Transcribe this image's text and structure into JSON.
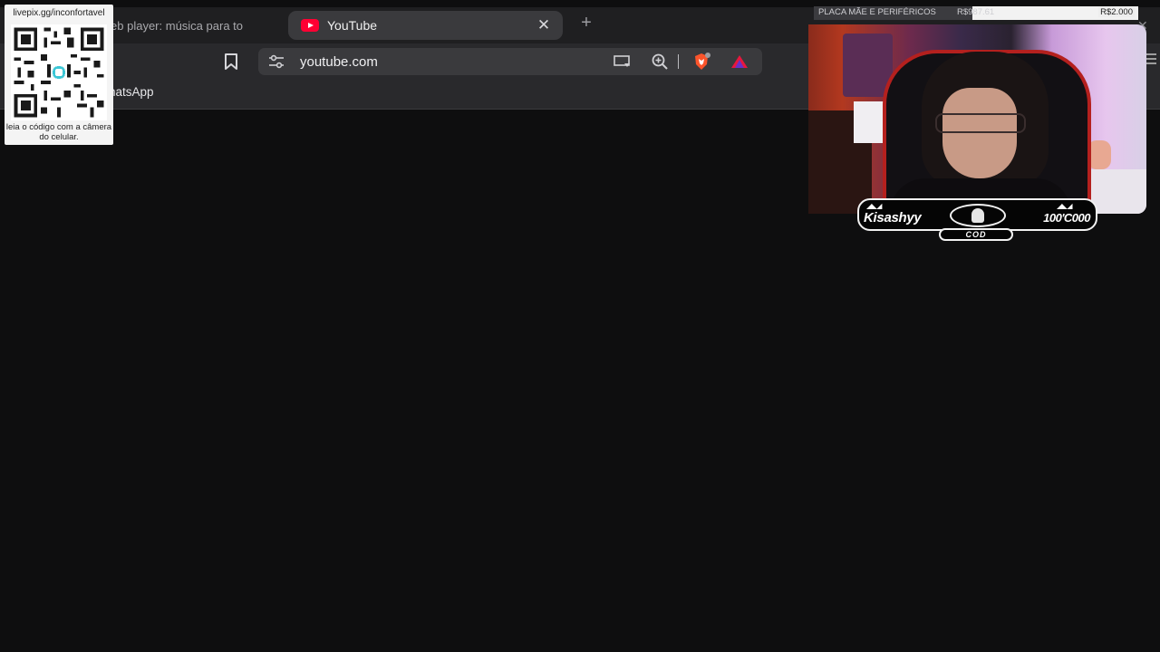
{
  "browser": {
    "tabs": [
      {
        "title": "Web player: música para to",
        "active": false
      },
      {
        "title": "YouTube",
        "active": true
      }
    ],
    "new_tab_symbol": "+",
    "close_symbol": "✕",
    "address_bar": {
      "url": "youtube.com"
    },
    "bookmarks_bar": {
      "items": [
        "WhatsApp"
      ],
      "visible_text": "natsApp"
    },
    "page_background": "#0e0e0f"
  },
  "overlay_qr": {
    "link": "livepix.gg/inconfortavel",
    "caption": "leia o código com a câmera do celular."
  },
  "donation_goal": {
    "label": "PLACA MÃE E PERIFÉRICOS",
    "current": "R$987.61",
    "target": "R$2.000",
    "progress": 0.49
  },
  "nameplate": {
    "name": "Kisashyy",
    "score": "100'C000",
    "bottom_text": "COD"
  },
  "icons": {
    "youtube": "youtube-logo-icon",
    "bookmark": "bookmark-icon",
    "site_settings": "tune-icon",
    "cast": "cast-icon",
    "zoom": "zoom-icon",
    "brave_shields": "brave-shield-icon",
    "brave_rewards": "rewards-triangle-icon"
  },
  "colors": {
    "youtube_red": "#ff0033",
    "brave_orange": "#fb542b",
    "overlay_red": "#b4201e"
  }
}
